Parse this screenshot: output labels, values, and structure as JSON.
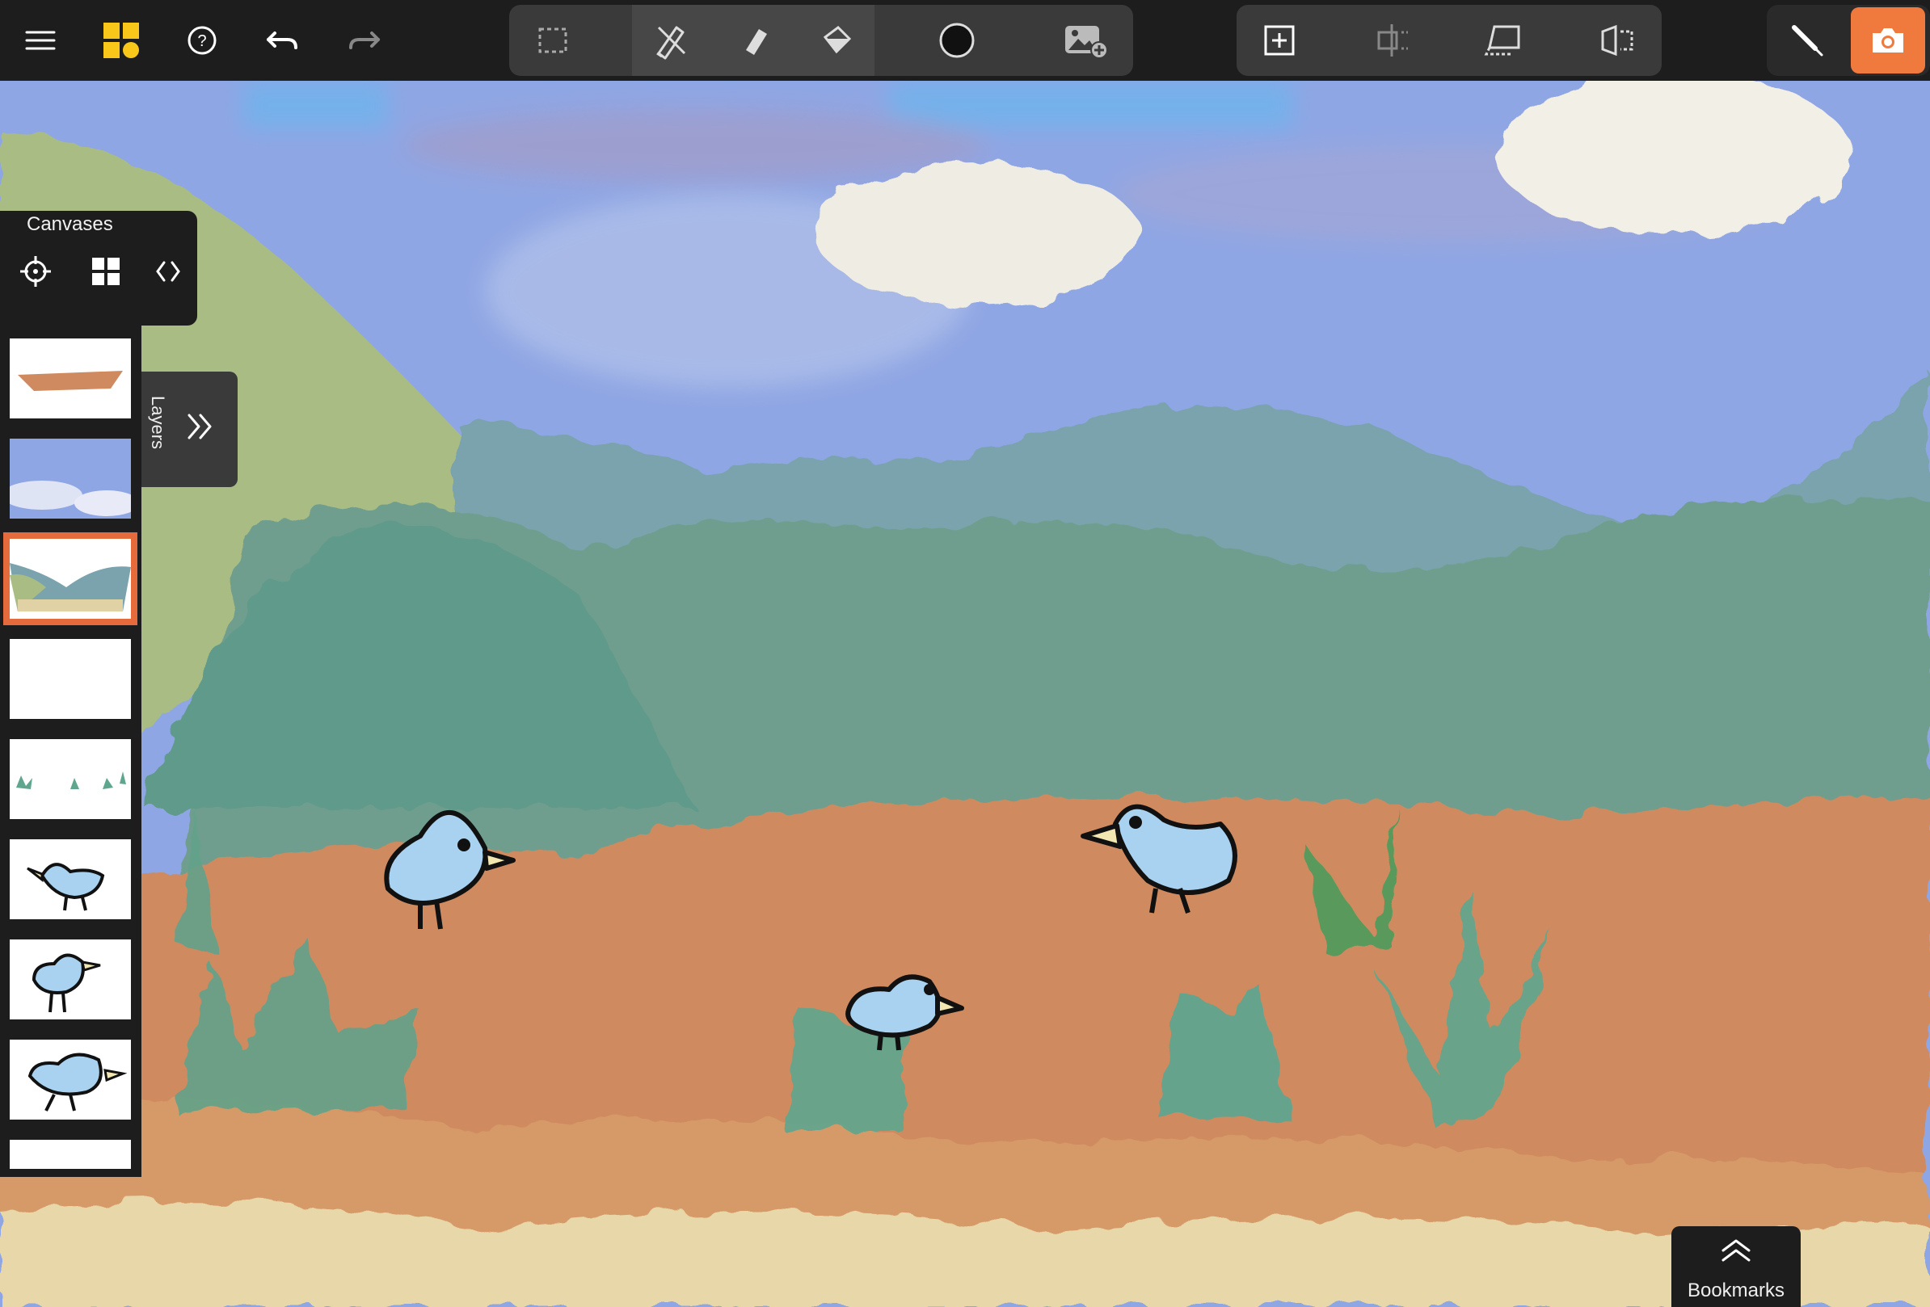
{
  "colors": {
    "toolbar_bg": "#1d1d1d",
    "tool_group_bg": "#3a3a3a",
    "accent": "#f07a3d",
    "selected_outline": "#e56a3c",
    "logo_yellow": "#f9c61a",
    "sky": "#8fa8e6",
    "hills": "#6f9f8e",
    "ground": "#cf8a5f",
    "sand": "#e8d8a8",
    "bird_body": "#a8d2ef"
  },
  "toolbar": {
    "left_icons": [
      "menu-icon",
      "app-logo-icon",
      "help-icon",
      "undo-icon",
      "redo-icon"
    ],
    "tools": [
      "selection-icon",
      "brush-tools-icon",
      "eraser-icon",
      "fill-icon",
      "color-swatch-icon",
      "insert-image-icon"
    ],
    "canvas_tools": [
      "add-canvas-icon",
      "align-icon",
      "transform-icon",
      "flip-icon"
    ],
    "right_icons": [
      "pen-mode-icon",
      "camera-icon"
    ]
  },
  "canvases_panel": {
    "title": "Canvases",
    "icons": [
      "target-icon",
      "grid-icon",
      "code-brackets-icon"
    ],
    "thumbnails": [
      {
        "label": "ground-strip"
      },
      {
        "label": "sky"
      },
      {
        "label": "hills",
        "selected": true
      },
      {
        "label": "blank"
      },
      {
        "label": "grass"
      },
      {
        "label": "bird-1"
      },
      {
        "label": "bird-2"
      },
      {
        "label": "bird-3"
      },
      {
        "label": "partial"
      }
    ]
  },
  "layers_tab": {
    "label": "Layers"
  },
  "bookmarks": {
    "label": "Bookmarks"
  }
}
